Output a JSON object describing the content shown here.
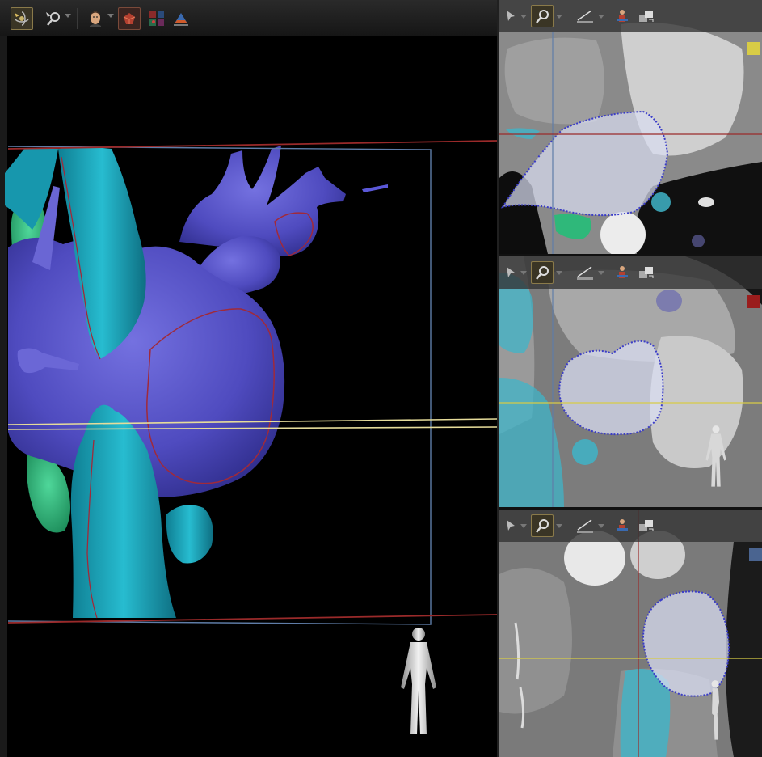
{
  "colors": {
    "axial_marker": "#d8cc45",
    "coronal_marker": "#9a1c1c",
    "sagittal_marker": "#4a6490",
    "heart_surface": "#5552c8",
    "vessel_surface": "#1aa3b8",
    "green_structure": "#2fb87a",
    "contour_line": "#a02a3a",
    "reference_line_yellow": "#e6dc9a",
    "reference_line_red": "#9a2a2a",
    "reference_line_blue": "#5f7da8"
  },
  "main_toolbar": {
    "tools": [
      {
        "icon": "rotate-3d-icon",
        "active": true,
        "dropdown": false
      },
      {
        "icon": "zoom-icon",
        "active": false,
        "dropdown": true
      },
      {
        "icon": "head-orientation-icon",
        "active": false,
        "dropdown": true
      },
      {
        "icon": "render-mode-icon",
        "active": true,
        "dropdown": false
      },
      {
        "icon": "segment-color-icon",
        "active": false,
        "dropdown": false
      },
      {
        "icon": "cut-plane-icon",
        "active": false,
        "dropdown": false
      }
    ]
  },
  "slice_toolbar": {
    "tools": [
      {
        "icon": "pointer-icon",
        "active": false,
        "dropdown": true
      },
      {
        "icon": "zoom-icon",
        "active": true,
        "dropdown": true
      },
      {
        "icon": "measure-ruler-icon",
        "active": false,
        "dropdown": true
      },
      {
        "icon": "person-orientation-icon",
        "active": false,
        "dropdown": false
      },
      {
        "icon": "sync-views-icon",
        "active": false,
        "dropdown": false
      }
    ]
  },
  "views": {
    "main": {
      "name": "3d-view",
      "icon": "orientation-figure-icon"
    },
    "axial": {
      "name": "axial-view",
      "marker": "yellow"
    },
    "coronal": {
      "name": "coronal-view",
      "marker": "red",
      "icon": "orientation-figure-icon"
    },
    "sagittal": {
      "name": "sagittal-view",
      "marker": "blue",
      "icon": "orientation-figure-icon"
    }
  }
}
